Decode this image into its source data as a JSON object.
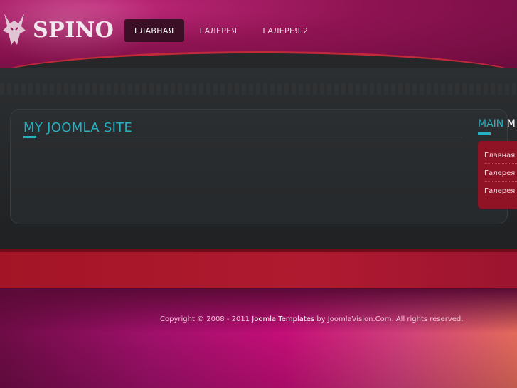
{
  "logo": {
    "text": "SPINO",
    "icon": "dragon-head-icon"
  },
  "nav": {
    "items": [
      {
        "label": "ГЛАВНАЯ",
        "active": true
      },
      {
        "label": "ГАЛЕРЕЯ",
        "active": false
      },
      {
        "label": "ГАЛЕРЕЯ 2",
        "active": false
      }
    ]
  },
  "main": {
    "title": "MY JOOMLA SITE"
  },
  "sidebar": {
    "title_colored": "MAIN",
    "title_rest": "M",
    "menu": [
      "Главная",
      "Галерея",
      "Галерея"
    ]
  },
  "footer": {
    "prefix": "Copyright © 2008 - 2011",
    "link": "Joomla Templates",
    "suffix": "by JoomlaVision.Com. All rights reserved."
  },
  "colors": {
    "accent": "#27b2c4",
    "header": "#8e1352",
    "dark": "#26292b",
    "red_band": "#a31526"
  }
}
